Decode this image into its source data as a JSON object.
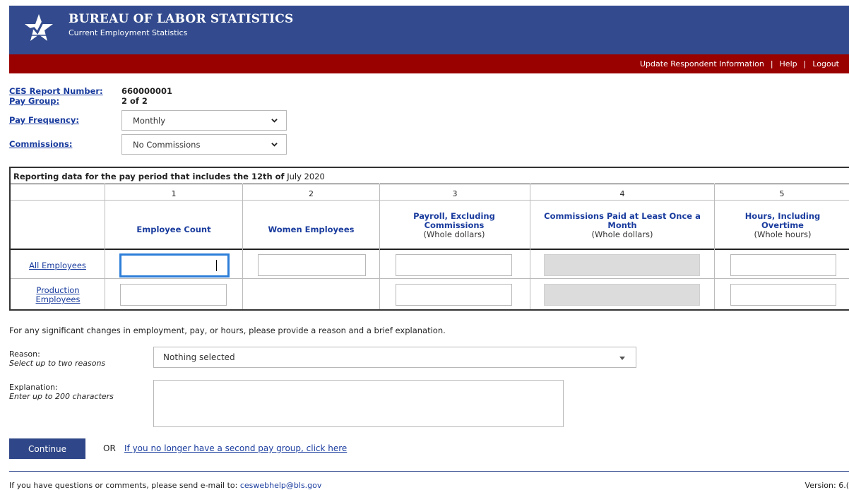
{
  "header": {
    "agency": "BUREAU OF LABOR STATISTICS",
    "program": "Current Employment Statistics",
    "logo_icon": "bls-star-logo-icon",
    "bar_color": "#334b8e",
    "nav_bar_color": "#990000",
    "nav": {
      "update": "Update Respondent Information",
      "separator": "|",
      "help": "Help",
      "logout": "Logout"
    }
  },
  "fields": {
    "report_number_label": "CES Report Number:",
    "report_number_value": "660000001",
    "pay_group_label": "Pay Group:",
    "pay_group_value": "2 of 2",
    "pay_frequency_label": "Pay Frequency:",
    "pay_frequency_value": "Monthly",
    "commissions_label": "Commissions:",
    "commissions_value": "No Commissions"
  },
  "table": {
    "caption_bold": "Reporting data for the pay period that includes the 12th of",
    "caption_period": "July 2020",
    "columns": [
      {
        "number": "1",
        "title": "Employee Count",
        "unit": ""
      },
      {
        "number": "2",
        "title": "Women Employees",
        "unit": ""
      },
      {
        "number": "3",
        "title": "Payroll, Excluding Commissions",
        "unit": "(Whole dollars)"
      },
      {
        "number": "4",
        "title": "Commissions Paid at Least Once a Month",
        "unit": "(Whole dollars)"
      },
      {
        "number": "5",
        "title": "Hours, Including Overtime",
        "unit": "(Whole hours)"
      }
    ],
    "rows": [
      {
        "label": "All Employees"
      },
      {
        "label": "Production Employees"
      }
    ]
  },
  "explanation_section": {
    "intro": "For any significant changes in employment, pay, or hours, please provide a reason and a brief explanation.",
    "reason_label": "Reason:",
    "reason_hint": "Select up to two reasons",
    "reason_value": "Nothing selected",
    "explanation_label": "Explanation:",
    "explanation_hint": "Enter up to 200 characters",
    "explanation_value": ""
  },
  "actions": {
    "continue_label": "Continue",
    "or_text": "OR",
    "no_second_group_link": "If you no longer have a second pay group, click here"
  },
  "footer": {
    "contact_text": "If you have questions or comments, please send e-mail to:",
    "email": "ceswebhelp@bls.gov",
    "version": "Version: 6.("
  }
}
